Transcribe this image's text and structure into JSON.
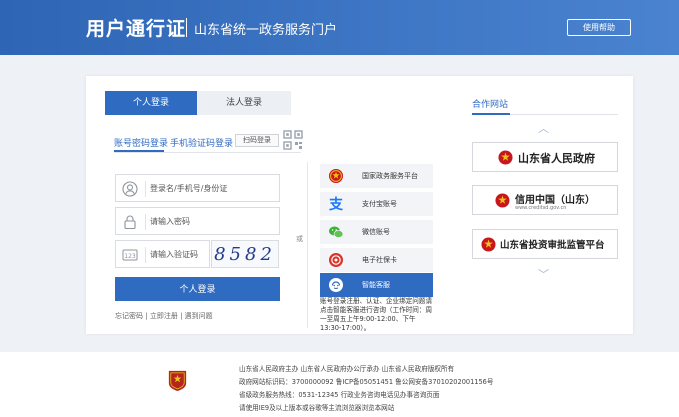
{
  "header": {
    "title": "用户通行证",
    "subtitle": "山东省统一政务服务门户",
    "help_label": "使用帮助"
  },
  "tabs": {
    "personal": "个人登录",
    "legal": "法人登录"
  },
  "subtabs": {
    "account": "账号密码登录",
    "sms": "手机验证码登录",
    "scan": "扫码登录"
  },
  "fields": {
    "username_placeholder": "登录名/手机号/身份证",
    "password_placeholder": "请输入密码",
    "captcha_placeholder": "请输入验证码",
    "captcha_text": "8582"
  },
  "login_button": "个人登录",
  "links": {
    "forgot": "忘记密码",
    "sep1": "|",
    "register": "立即注册",
    "sep2": "|",
    "faq": "遇到问题"
  },
  "or_label": "或",
  "alt_logins": [
    {
      "label": "国家政务服务平台",
      "icon": "national-emblem-icon"
    },
    {
      "label": "支付宝账号",
      "icon": "alipay-icon"
    },
    {
      "label": "微信账号",
      "icon": "wechat-icon"
    },
    {
      "label": "电子社保卡",
      "icon": "social-security-card-icon"
    },
    {
      "label": "智能客服",
      "icon": "customer-service-icon"
    }
  ],
  "service_note": "账号登录注册、认证、企业绑定问题请点击智能客服进行咨询（工作时间：周一至周五上午9:00-12:00、下午13:30-17:00）。",
  "partners": {
    "title": "合作网站",
    "items": [
      {
        "name": "山东省人民政府",
        "sub": ""
      },
      {
        "name": "信用中国（山东）",
        "sub": "www.creditsd.gov.cn"
      },
      {
        "name": "山东省投资审批监管平台",
        "sub": ""
      }
    ]
  },
  "footer": {
    "line1": "山东省人民政府主办   山东省人民政府办公厅承办   山东省人民政府版权所有",
    "line2": "政府网站标识码：3700000092   鲁ICP备05051451   鲁公网安备37010202001156号",
    "line3": "省级政务服务热线：0531-12345   行政业务咨询电话见办事咨询页面",
    "line4": "请使用IE9及以上版本或谷歌等主流浏览器浏览本网站"
  },
  "colors": {
    "primary": "#2f6bc1",
    "header_start": "#2e66b5",
    "header_end": "#4a83d0",
    "emblem_red": "#c8161d",
    "emblem_gold": "#f2c21a"
  }
}
